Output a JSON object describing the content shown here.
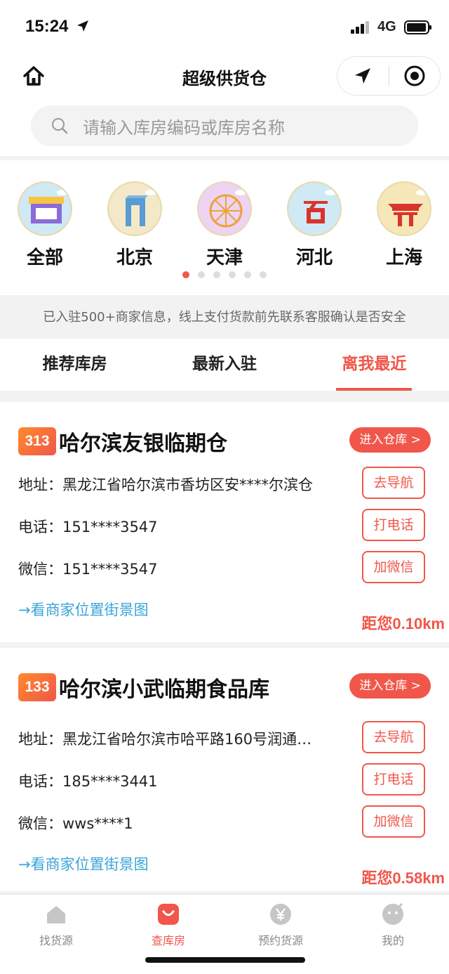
{
  "status_bar": {
    "time": "15:24",
    "network": "4G"
  },
  "header": {
    "title": "超级供货仓"
  },
  "search": {
    "placeholder": "请输入库房编码或库房名称"
  },
  "categories": [
    {
      "label": "全部",
      "icon": "storefront-icon"
    },
    {
      "label": "北京",
      "icon": "beijing-cctv-building-icon"
    },
    {
      "label": "天津",
      "icon": "tianjin-ferris-wheel-icon"
    },
    {
      "label": "河北",
      "icon": "hebei-emblem-icon"
    },
    {
      "label": "上海",
      "icon": "shanghai-china-pavilion-icon"
    }
  ],
  "carousel": {
    "page_count": 6,
    "active_index": 0
  },
  "notice": "已入驻500+商家信息，线上支付货款前先联系客服确认是否安全",
  "tabs": [
    "推荐库房",
    "最新入驻",
    "离我最近"
  ],
  "active_tab": 2,
  "warehouses": [
    {
      "code": "313",
      "name": "哈尔滨友银临期仓",
      "enter_label": "进入仓库 >",
      "address": "地址：黑龙江省哈尔滨市香坊区安****尔滨仓",
      "phone": "电话：151****3547",
      "wechat": "微信：151****3547",
      "nav_label": "去导航",
      "call_label": "打电话",
      "wechat_label": "加微信",
      "street_view": "→看商家位置街景图",
      "distance": "距您0.10km"
    },
    {
      "code": "133",
      "name": "哈尔滨小武临期食品库",
      "enter_label": "进入仓库 >",
      "address": "地址：黑龙江省哈尔滨市哈平路160号润通…",
      "phone": "电话：185****3441",
      "wechat": "微信：wws****1",
      "nav_label": "去导航",
      "call_label": "打电话",
      "wechat_label": "加微信",
      "street_view": "→看商家位置街景图",
      "distance": "距您0.58km"
    }
  ],
  "tabbar": [
    {
      "label": "找货源",
      "icon": "home-icon"
    },
    {
      "label": "查库房",
      "icon": "shopping-bag-icon"
    },
    {
      "label": "预约货源",
      "icon": "yen-coin-icon"
    },
    {
      "label": "我的",
      "icon": "profile-face-icon"
    }
  ],
  "tabbar_active": 1,
  "colors": {
    "accent": "#f0574a",
    "link": "#3aa4d8",
    "badge_from": "#ff8a2c"
  }
}
